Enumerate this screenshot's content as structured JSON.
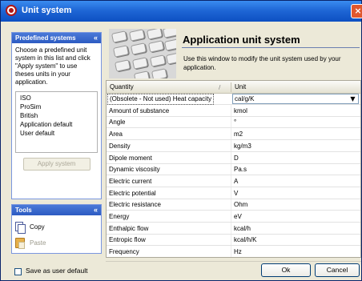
{
  "window": {
    "title": "Unit system",
    "close_glyph": "×"
  },
  "left": {
    "predefined": {
      "title": "Predefined systems",
      "collapse_glyph": "«",
      "description": "Choose a predefined unit system in this list and click \"Apply system\" to use theses units in your application.",
      "systems": [
        "ISO",
        "ProSim",
        "British",
        "Application default",
        "User default"
      ],
      "apply_label": "Apply system"
    },
    "tools": {
      "title": "Tools",
      "collapse_glyph": "«",
      "copy_label": "Copy",
      "paste_label": "Paste"
    }
  },
  "header": {
    "title": "Application unit system",
    "subtitle": "Use this window to modify the unit system used by your application."
  },
  "grid": {
    "col_quantity": "Quantity",
    "col_unit": "Unit",
    "sort_glyph": "/",
    "dropdown_glyph": "▼",
    "rows": [
      {
        "quantity": "(Obsolete - Not used) Heat capacity",
        "unit": "cal/g/K"
      },
      {
        "quantity": "Amount of substance",
        "unit": "kmol"
      },
      {
        "quantity": "Angle",
        "unit": "°"
      },
      {
        "quantity": "Area",
        "unit": "m2"
      },
      {
        "quantity": "Density",
        "unit": "kg/m3"
      },
      {
        "quantity": "Dipole moment",
        "unit": "D"
      },
      {
        "quantity": "Dynamic viscosity",
        "unit": "Pa.s"
      },
      {
        "quantity": "Electric current",
        "unit": "A"
      },
      {
        "quantity": "Electric potential",
        "unit": "V"
      },
      {
        "quantity": "Electric resistance",
        "unit": "Ohm"
      },
      {
        "quantity": "Energy",
        "unit": "eV"
      },
      {
        "quantity": "Enthalpic flow",
        "unit": "kcal/h"
      },
      {
        "quantity": "Entropic flow",
        "unit": "kcal/h/K"
      },
      {
        "quantity": "Frequency",
        "unit": "Hz"
      }
    ]
  },
  "footer": {
    "save_default_label": "Save as user default",
    "ok_label": "Ok",
    "cancel_label": "Cancel"
  }
}
